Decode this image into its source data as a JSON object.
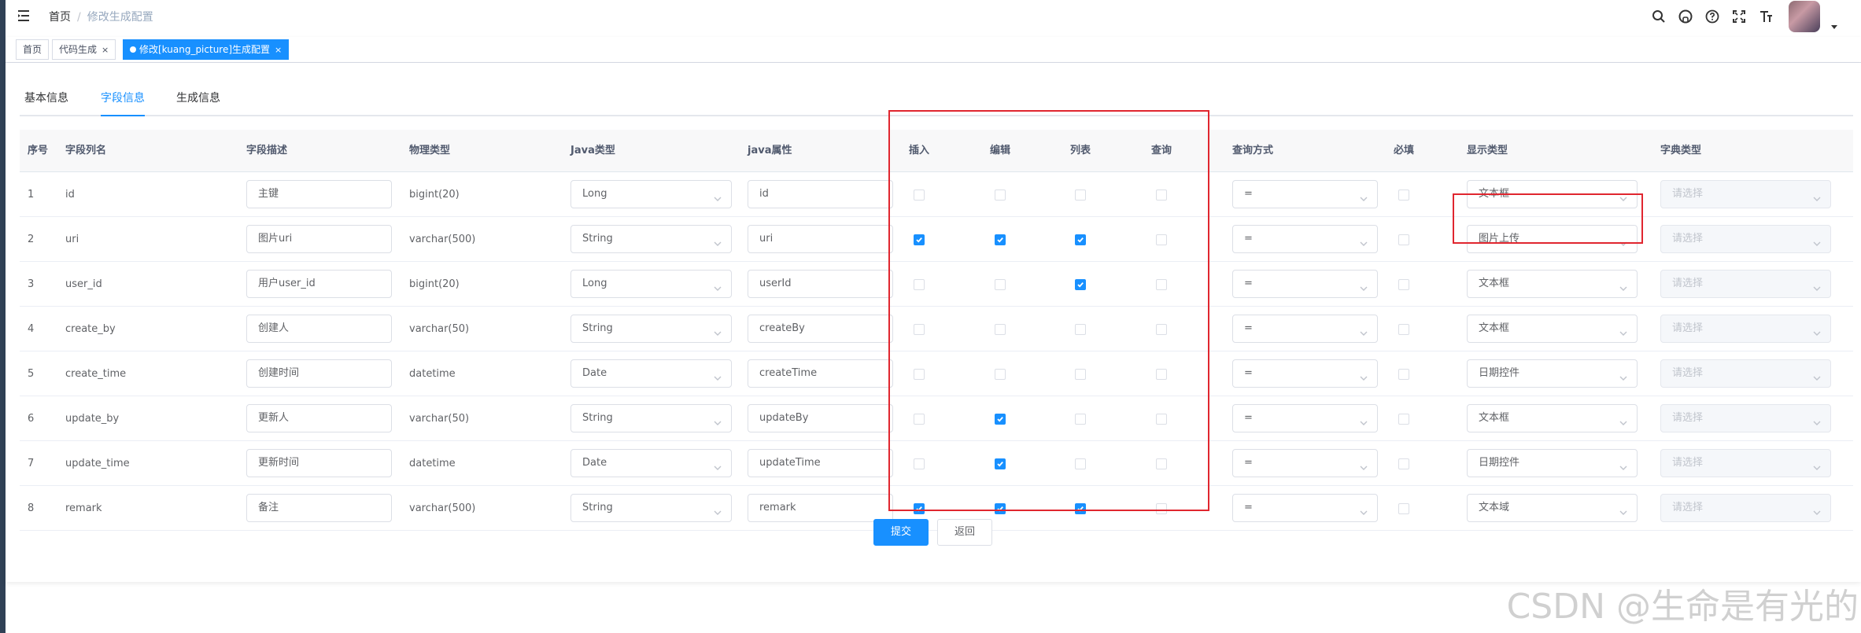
{
  "breadcrumb": {
    "home": "首页",
    "sep": "/",
    "current": "修改生成配置"
  },
  "icons": [
    "hamburger-icon",
    "search-icon",
    "github-icon",
    "question-icon",
    "fullscreen-icon",
    "font-size-icon"
  ],
  "tags": [
    {
      "label": "首页",
      "close": ""
    },
    {
      "label": "代码生成",
      "close": "×"
    },
    {
      "label": "修改[kuang_picture]生成配置",
      "close": "×"
    }
  ],
  "tabs": [
    "基本信息",
    "字段信息",
    "生成信息"
  ],
  "active_tab": "字段信息",
  "columns": [
    "序号",
    "字段列名",
    "字段描述",
    "物理类型",
    "Java类型",
    "java属性",
    "插入",
    "编辑",
    "列表",
    "查询",
    "查询方式",
    "必填",
    "显示类型",
    "字典类型"
  ],
  "dict_placeholder": "请选择",
  "rows": [
    {
      "no": "1",
      "column": "id",
      "desc": "主键",
      "db_type": "bigint(20)",
      "java_type": "Long",
      "java_field": "id",
      "insert": false,
      "edit": false,
      "list": false,
      "query": false,
      "query_type": "=",
      "required": false,
      "html_type": "文本框"
    },
    {
      "no": "2",
      "column": "uri",
      "desc": "图片uri",
      "db_type": "varchar(500)",
      "java_type": "String",
      "java_field": "uri",
      "insert": true,
      "edit": true,
      "list": true,
      "query": false,
      "query_type": "=",
      "required": false,
      "html_type": "图片上传"
    },
    {
      "no": "3",
      "column": "user_id",
      "desc": "用户user_id",
      "db_type": "bigint(20)",
      "java_type": "Long",
      "java_field": "userId",
      "insert": false,
      "edit": false,
      "list": true,
      "query": false,
      "query_type": "=",
      "required": false,
      "html_type": "文本框"
    },
    {
      "no": "4",
      "column": "create_by",
      "desc": "创建人",
      "db_type": "varchar(50)",
      "java_type": "String",
      "java_field": "createBy",
      "insert": false,
      "edit": false,
      "list": false,
      "query": false,
      "query_type": "=",
      "required": false,
      "html_type": "文本框"
    },
    {
      "no": "5",
      "column": "create_time",
      "desc": "创建时间",
      "db_type": "datetime",
      "java_type": "Date",
      "java_field": "createTime",
      "insert": false,
      "edit": false,
      "list": false,
      "query": false,
      "query_type": "=",
      "required": false,
      "html_type": "日期控件"
    },
    {
      "no": "6",
      "column": "update_by",
      "desc": "更新人",
      "db_type": "varchar(50)",
      "java_type": "String",
      "java_field": "updateBy",
      "insert": false,
      "edit": true,
      "list": false,
      "query": false,
      "query_type": "=",
      "required": false,
      "html_type": "文本框"
    },
    {
      "no": "7",
      "column": "update_time",
      "desc": "更新时间",
      "db_type": "datetime",
      "java_type": "Date",
      "java_field": "updateTime",
      "insert": false,
      "edit": true,
      "list": false,
      "query": false,
      "query_type": "=",
      "required": false,
      "html_type": "日期控件"
    },
    {
      "no": "8",
      "column": "remark",
      "desc": "备注",
      "db_type": "varchar(500)",
      "java_type": "String",
      "java_field": "remark",
      "insert": true,
      "edit": true,
      "list": true,
      "query": false,
      "query_type": "=",
      "required": false,
      "html_type": "文本域"
    }
  ],
  "buttons": {
    "submit": "提交",
    "back": "返回"
  },
  "watermark": "CSDN @生命是有光的",
  "colors": {
    "primary": "#1890ff",
    "highlight_box": "#e0262f",
    "sidebar": "#304156"
  }
}
